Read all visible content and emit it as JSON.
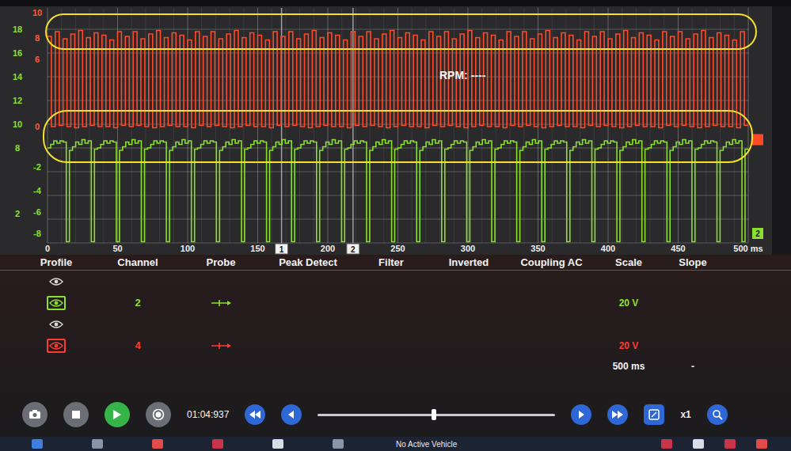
{
  "chart": {
    "rpm": "RPM: ----",
    "x_ticks": [
      "0",
      "50",
      "100",
      "150",
      "200",
      "250",
      "300",
      "350",
      "400",
      "450",
      "500 ms"
    ],
    "y_labels_left": [
      {
        "text": "18",
        "value": 18
      },
      {
        "text": "16",
        "value": 16
      },
      {
        "text": "14",
        "value": 14
      },
      {
        "text": "12",
        "value": 12
      },
      {
        "text": "10",
        "value": 10
      },
      {
        "text": "8",
        "value": 8
      },
      {
        "text": "2",
        "value": 2.5
      }
    ],
    "y_labels_right": [
      {
        "text": "10",
        "value": 19.4,
        "color": "#ff5a3c"
      },
      {
        "text": "8",
        "value": 17.3,
        "color": "#ff5a3c"
      },
      {
        "text": "6",
        "value": 15.5,
        "color": "#ff5a3c"
      },
      {
        "text": "0",
        "value": 9.8,
        "color": "#ff5a3c"
      },
      {
        "text": "-2",
        "value": 6.4,
        "color": "#8be02c"
      },
      {
        "text": "-4",
        "value": 4.4,
        "color": "#8be02c"
      },
      {
        "text": "-6",
        "value": 2.6,
        "color": "#8be02c"
      },
      {
        "text": "-8",
        "value": 0.8,
        "color": "#8be02c"
      }
    ],
    "cursors": [
      {
        "label": "1",
        "time": 167
      },
      {
        "label": "2",
        "time": 218
      }
    ],
    "markers": [
      {
        "kind": "plain",
        "color": "#ff4a28",
        "value": 8.7
      },
      {
        "kind": "labeled",
        "label": "2",
        "color": "#8be02c",
        "value": 0.8
      }
    ],
    "series": [
      {
        "color": "#ff4a28",
        "values": [
          17.4,
          9.8,
          17.8,
          9.9,
          17.2,
          9.8,
          17.6,
          9.7,
          17.9,
          9.8,
          17.3,
          9.9,
          17.7,
          9.8,
          17.5,
          9.8,
          17.1,
          9.7,
          17.8,
          9.9,
          17.4,
          9.8,
          17.8,
          9.9,
          17.2,
          9.8,
          17.6,
          9.7,
          17.9,
          9.8,
          17.3,
          9.9,
          17.7,
          9.8,
          17.5,
          9.8,
          17.1,
          9.7,
          17.8,
          9.9,
          17.4,
          9.8,
          17.8,
          9.9,
          17.2,
          9.8,
          17.6,
          9.7,
          17.9,
          9.8,
          17.3,
          9.9,
          17.7,
          9.8,
          17.5,
          9.8,
          17.1,
          9.7,
          17.8,
          9.9,
          17.4,
          9.8,
          17.8,
          9.9,
          17.2,
          9.8,
          17.6,
          9.7,
          17.9,
          9.8,
          17.3,
          9.9,
          17.7,
          9.8,
          17.5,
          9.8,
          17.1,
          9.7,
          17.8,
          9.9,
          17.4,
          9.8,
          17.8,
          9.9,
          17.2,
          9.8,
          17.6,
          9.7,
          17.9,
          9.8,
          17.3,
          9.9,
          17.7,
          9.8,
          17.5,
          9.8,
          17.1,
          9.7,
          17.8,
          9.9,
          17.4,
          9.8,
          17.8,
          9.9,
          17.2,
          9.8,
          17.6,
          9.7,
          17.9,
          9.8,
          17.3,
          9.9,
          17.7,
          9.8,
          17.5,
          9.8,
          17.1,
          9.7,
          17.8,
          9.9,
          17.4,
          9.8,
          17.8,
          9.9,
          17.2,
          9.8,
          17.6,
          9.7,
          17.9,
          9.8,
          17.3,
          9.9,
          17.7,
          9.8,
          17.5,
          9.8,
          17.1,
          9.7,
          17.8,
          9.9,
          17.4,
          9.8,
          17.8,
          9.9,
          17.2,
          9.8,
          17.6,
          9.7,
          17.9,
          9.8,
          17.3,
          9.9,
          17.7,
          9.8,
          17.5,
          9.8,
          17.1,
          9.7,
          17.8,
          9.9,
          17.4,
          9.8,
          17.8,
          9.9,
          17.2,
          9.8,
          17.6,
          9.7,
          17.9,
          9.8,
          17.3,
          9.9,
          17.7,
          9.8,
          17.5,
          9.8,
          17.1,
          9.7,
          17.8,
          9.9
        ]
      },
      {
        "color": "#8be02c",
        "values": [
          8.0,
          8.3,
          8.6,
          8.4,
          8.6,
          8.5,
          0.1,
          7.8,
          8.1,
          8.5,
          8.3,
          8.7,
          8.4,
          8.6,
          0.1,
          7.9,
          8.0,
          8.3,
          8.6,
          8.4,
          8.6,
          8.5,
          0.1,
          7.8,
          8.1,
          8.5,
          8.3,
          8.7,
          8.4,
          8.6,
          0.1,
          7.9,
          8.0,
          8.3,
          8.6,
          8.4,
          8.6,
          8.5,
          0.1,
          7.8,
          8.1,
          8.5,
          8.3,
          8.7,
          8.4,
          8.6,
          0.1,
          7.9,
          8.0,
          8.3,
          8.6,
          8.4,
          8.6,
          8.5,
          0.1,
          7.8,
          8.1,
          8.5,
          8.3,
          8.7,
          8.4,
          8.6,
          0.1,
          7.9,
          8.0,
          8.3,
          8.6,
          8.4,
          8.6,
          8.5,
          0.1,
          7.8,
          8.1,
          8.5,
          8.3,
          8.7,
          8.4,
          8.6,
          0.1,
          7.9,
          8.0,
          8.3,
          8.6,
          8.4,
          8.6,
          8.5,
          0.1,
          7.8,
          8.1,
          8.5,
          8.3,
          8.7,
          8.4,
          8.6,
          0.1,
          7.9,
          8.0,
          8.3,
          8.6,
          8.4,
          8.6,
          8.5,
          0.1,
          7.8,
          8.1,
          8.5,
          8.3,
          8.7,
          8.4,
          8.6,
          0.1,
          7.9,
          8.0,
          8.3,
          8.6,
          8.4,
          8.6,
          8.5,
          0.1,
          7.8,
          8.1,
          8.5,
          8.3,
          8.7,
          8.4,
          8.6,
          0.1,
          7.9,
          8.0,
          8.3,
          8.6,
          8.4,
          8.6,
          8.5,
          0.1,
          7.8,
          8.1,
          8.5,
          8.3,
          8.7,
          8.4,
          8.6,
          0.1,
          7.9,
          8.0,
          8.3,
          8.6,
          8.4,
          8.6,
          8.5,
          0.1,
          7.8,
          8.1,
          8.5,
          8.3,
          8.7,
          8.4,
          8.6,
          0.1,
          7.9,
          8.0,
          8.3,
          8.6,
          8.4,
          8.6,
          8.5,
          0.1,
          7.8,
          8.1,
          8.5,
          8.3,
          8.7,
          8.4,
          8.6,
          0.1,
          7.9,
          8.0,
          8.3,
          8.6,
          8.4,
          8.6,
          8.5,
          0.1,
          7.8,
          8.1,
          8.5,
          8.3,
          8.7,
          8.4,
          8.6,
          0.1,
          7.9,
          8.0,
          8.3,
          8.6,
          8.4,
          8.6,
          8.5,
          0.1,
          7.8,
          8.1,
          8.5,
          8.3,
          8.7,
          8.4,
          8.6,
          0.1,
          7.9,
          8.0,
          8.3,
          8.6,
          8.4,
          8.6,
          8.5,
          0.1,
          7.8,
          8.1,
          8.5,
          8.3,
          8.7,
          8.4,
          8.6,
          0.1,
          7.9
        ]
      }
    ]
  },
  "table": {
    "headers": [
      "Profile",
      "Channel",
      "Probe",
      "Peak Detect",
      "Filter",
      "Inverted",
      "Coupling AC",
      "Scale",
      "Slope"
    ],
    "rows": [
      {
        "kind": "empty",
        "active": false,
        "color": "#d8d8d8"
      },
      {
        "kind": "channel",
        "channel": "2",
        "scale": "20 V",
        "active": true,
        "color": "#8be02c"
      },
      {
        "kind": "empty",
        "active": false,
        "color": "#d8d8d8"
      },
      {
        "kind": "channel",
        "channel": "4",
        "scale": "20 V",
        "active": true,
        "color": "#ff3b30"
      }
    ],
    "timebase": "500 ms",
    "slope": "-"
  },
  "playback": {
    "time": "01:04:937",
    "level": 0.49,
    "speed": "x1"
  },
  "status_bar": {
    "vehicle": "No Active Vehicle"
  }
}
